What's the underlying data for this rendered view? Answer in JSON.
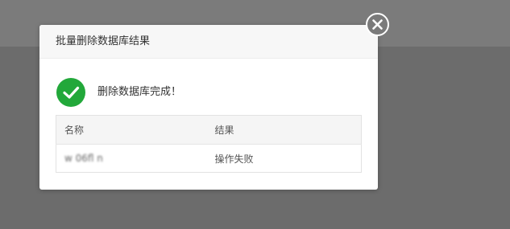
{
  "dialog": {
    "title": "批量删除数据库结果",
    "status_message": "删除数据库完成！",
    "icons": {
      "close": "close-icon",
      "status": "check-circle-icon"
    },
    "colors": {
      "success": "#22a83a",
      "error": "#e0161d"
    }
  },
  "table": {
    "headers": [
      "名称",
      "结果"
    ],
    "rows": [
      {
        "name": "w 06fl n",
        "result": "操作失败"
      }
    ]
  }
}
